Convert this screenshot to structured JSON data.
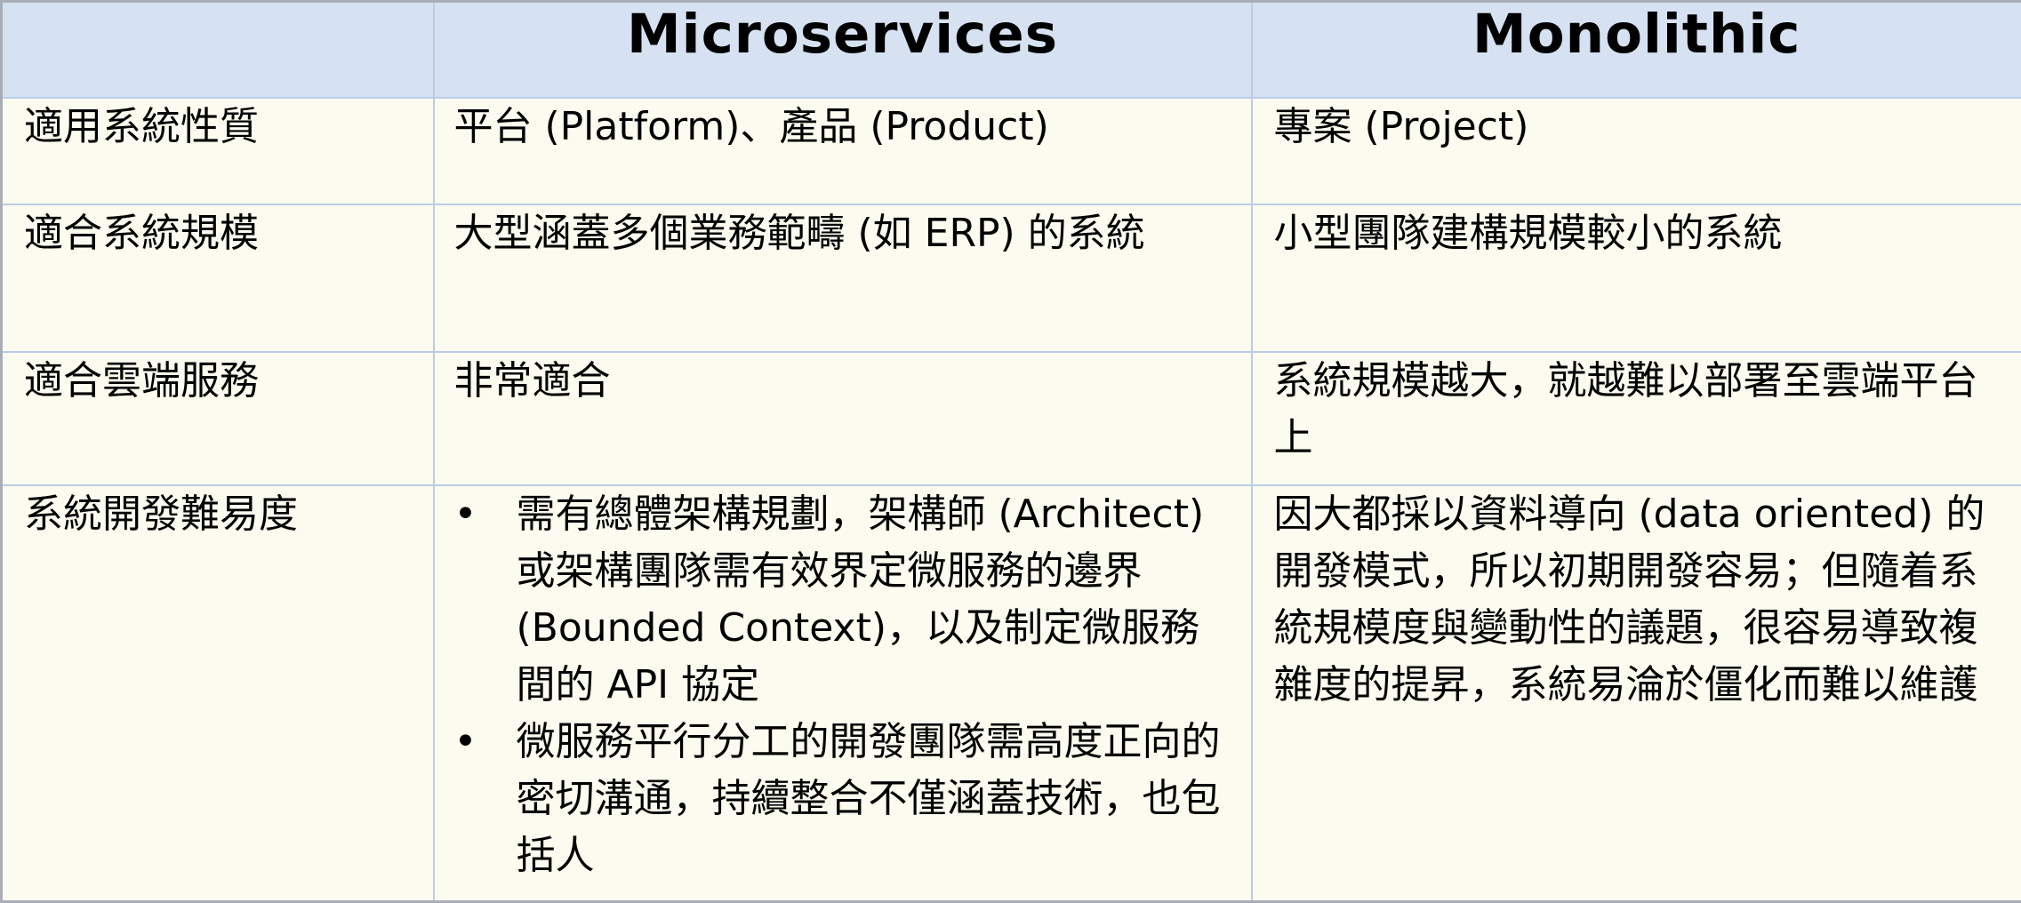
{
  "header": {
    "corner": "",
    "microservices": "Microservices",
    "monolithic": "Monolithic"
  },
  "rows": [
    {
      "label": "適用系統性質",
      "microservices": "平台 (Platform)、產品 (Product)",
      "monolithic": "專案 (Project)"
    },
    {
      "label": "適合系統規模",
      "microservices": "大型涵蓋多個業務範疇 (如 ERP) 的系統",
      "monolithic": "小型團隊建構規模較小的系統"
    },
    {
      "label": "適合雲端服務",
      "microservices": "非常適合",
      "monolithic": "系統規模越大，就越難以部署至雲端平台上"
    },
    {
      "label": "系統開發難易度",
      "microservices_bullets": [
        "需有總體架構規劃，架構師 (Architect) 或架構團隊需有效界定微服務的邊界 (Bounded Context)，以及制定微服務間的 API 協定",
        "微服務平行分工的開發團隊需高度正向的密切溝通，持續整合不僅涵蓋技術，也包括人"
      ],
      "monolithic": "因大都採以資料導向 (data oriented) 的開發模式，所以初期開發容易；但隨着系統規模度與變動性的議題，很容易導致複雜度的提昇，系統易淪於僵化而難以維護"
    }
  ],
  "bullet_glyph": "•"
}
